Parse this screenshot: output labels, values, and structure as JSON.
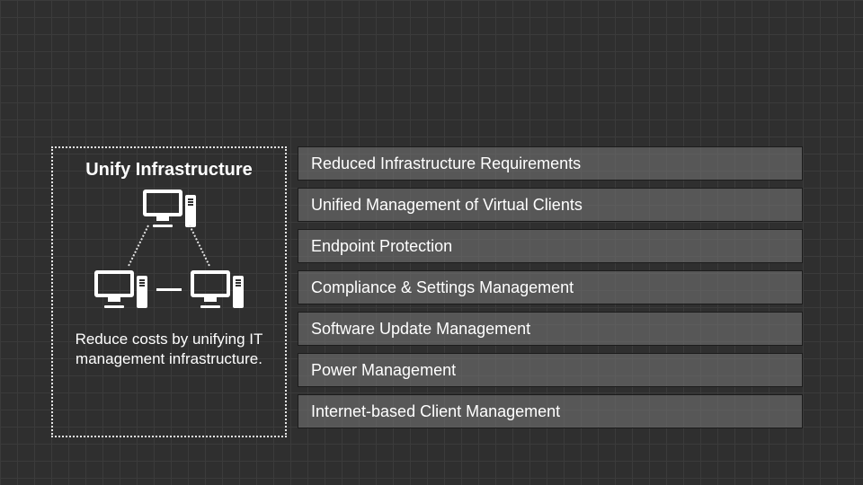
{
  "left": {
    "title": "Unify Infrastructure",
    "subtitle": "Reduce costs by unifying IT management infrastructure."
  },
  "features": [
    "Reduced Infrastructure Requirements",
    "Unified Management of Virtual Clients",
    "Endpoint Protection",
    "Compliance & Settings Management",
    "Software Update Management",
    "Power Management",
    "Internet-based Client Management"
  ]
}
